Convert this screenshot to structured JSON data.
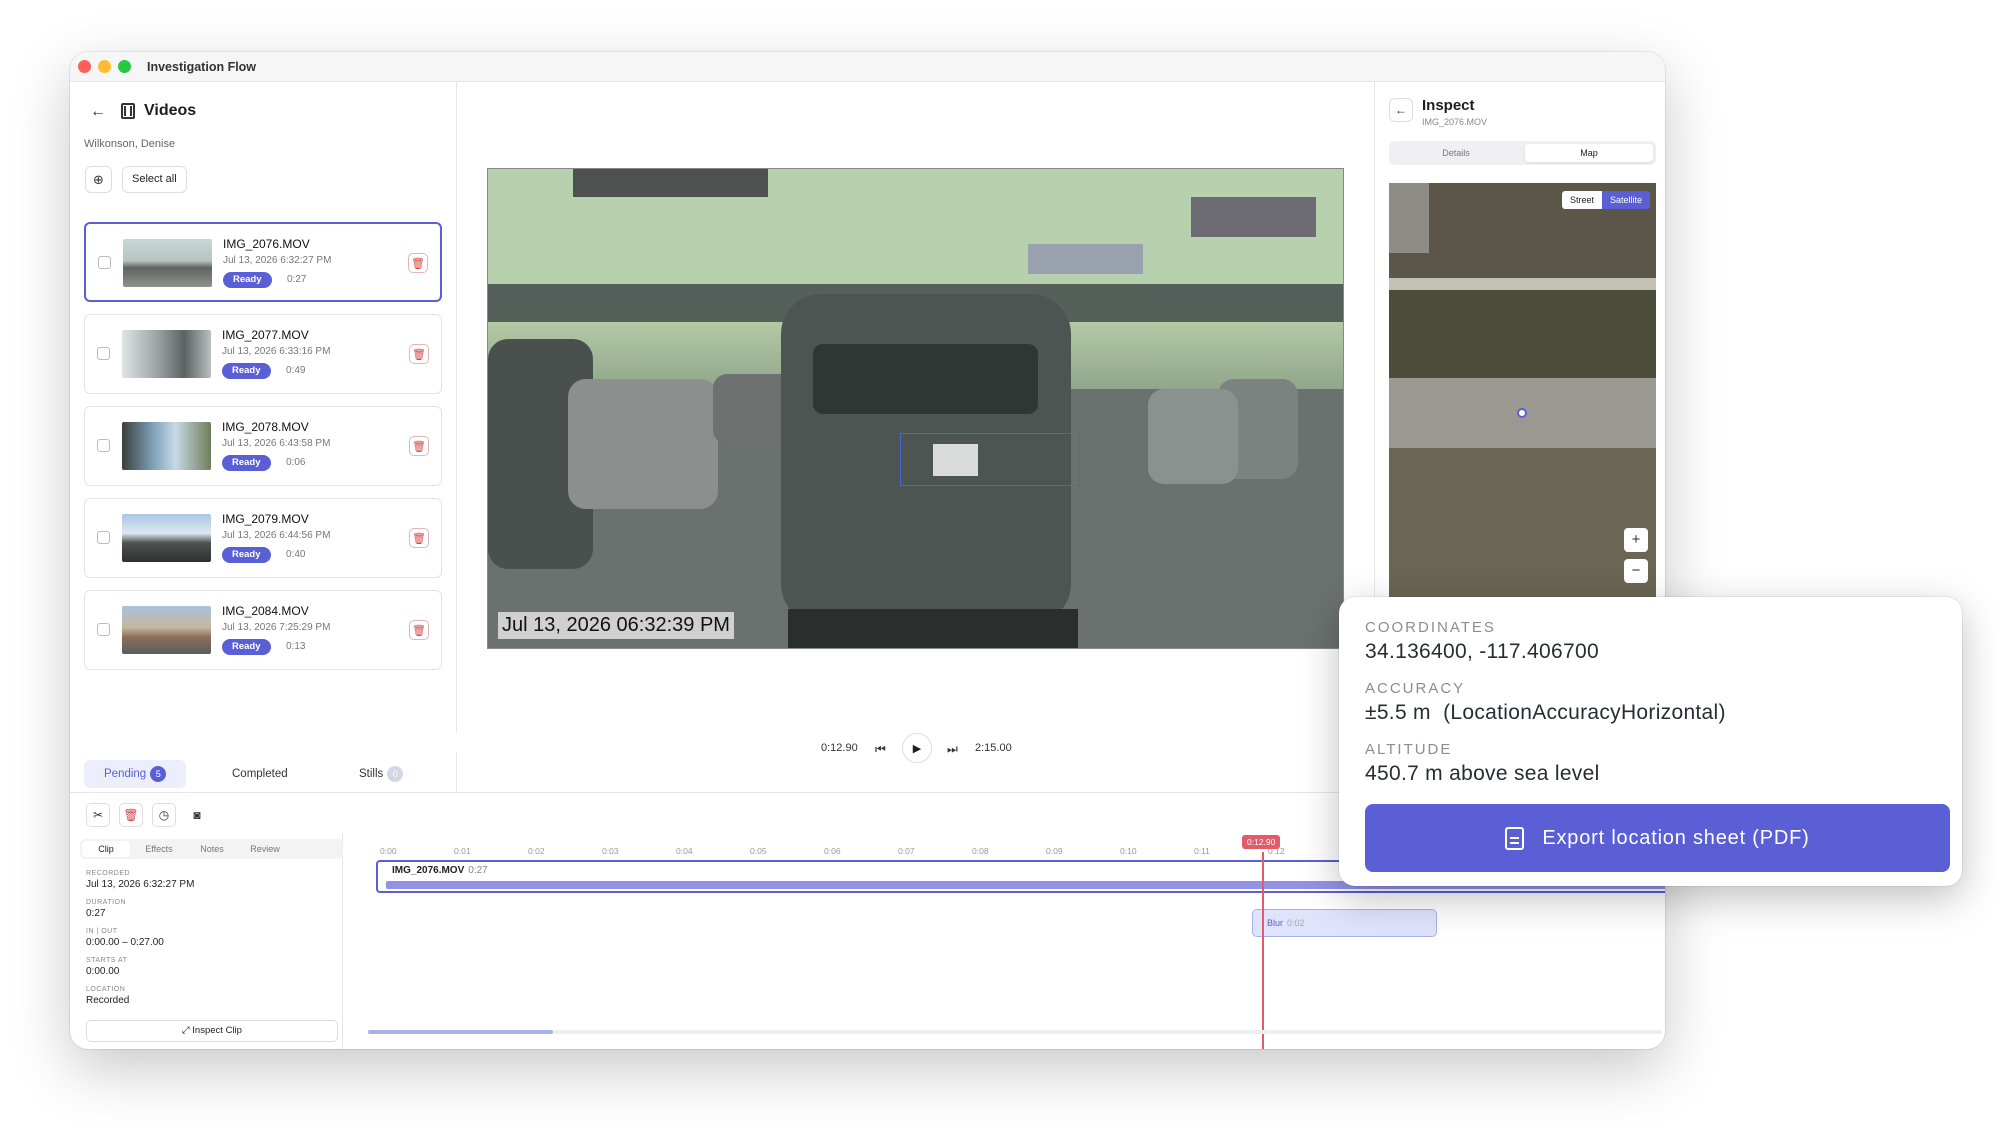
{
  "window": {
    "title": "Investigation Flow"
  },
  "sidebar": {
    "title": "Videos",
    "case_name": "Wilkonson, Denise",
    "select_all_label": "Select all",
    "videos": [
      {
        "name": "IMG_2076.MOV",
        "date": "Jul 13, 2026 6:32:27 PM",
        "status": "Ready",
        "duration": "0:27",
        "selected": true
      },
      {
        "name": "IMG_2077.MOV",
        "date": "Jul 13, 2026 6:33:16 PM",
        "status": "Ready",
        "duration": "0:49"
      },
      {
        "name": "IMG_2078.MOV",
        "date": "Jul 13, 2026 6:43:58 PM",
        "status": "Ready",
        "duration": "0:06"
      },
      {
        "name": "IMG_2079.MOV",
        "date": "Jul 13, 2026 6:44:56 PM",
        "status": "Ready",
        "duration": "0:40"
      },
      {
        "name": "IMG_2084.MOV",
        "date": "Jul 13, 2026 7:25:29 PM",
        "status": "Ready",
        "duration": "0:13"
      }
    ],
    "tabs": [
      {
        "label": "Pending",
        "count": "5"
      },
      {
        "label": "Completed"
      },
      {
        "label": "Stills",
        "count": "0"
      }
    ]
  },
  "player": {
    "timestamp_overlay": "Jul 13, 2026 06:32:39 PM",
    "current_time": "0:12.90",
    "total_time": "2:15.00"
  },
  "inspect": {
    "title": "Inspect",
    "file": "IMG_2076.MOV",
    "tabs": [
      "Details",
      "Map"
    ],
    "active_tab": "Map",
    "map_modes": [
      "Street",
      "Satellite"
    ],
    "active_map_mode": "Satellite",
    "zoom_in": "+",
    "zoom_out": "−"
  },
  "editor": {
    "panel_tabs": [
      "Clip",
      "Effects",
      "Notes",
      "Review"
    ],
    "fields": [
      {
        "label": "RECORDED",
        "value": "Jul 13, 2026 6:32:27 PM"
      },
      {
        "label": "DURATION",
        "value": "0:27"
      },
      {
        "label": "IN | OUT",
        "value": "0:00.00 – 0:27.00"
      },
      {
        "label": "STARTS AT",
        "value": "0:00.00"
      },
      {
        "label": "LOCATION",
        "value": "Recorded"
      }
    ],
    "inspect_clip_label": "Inspect Clip",
    "ruler_ticks": [
      "0:00",
      "0:01",
      "0:02",
      "0:03",
      "0:04",
      "0:05",
      "0:06",
      "0:07",
      "0:08",
      "0:09",
      "0:10",
      "0:11",
      "0:12"
    ],
    "playhead_label": "0:12.90",
    "clip": {
      "name": "IMG_2076.MOV",
      "duration": "0:27"
    },
    "effect": {
      "name": "Blur",
      "duration": "0:02"
    }
  },
  "location": {
    "coordinates_label": "COORDINATES",
    "coordinates": "34.136400, -117.406700",
    "accuracy_label": "ACCURACY",
    "accuracy": "±5.5 m  (LocationAccuracyHorizontal)",
    "altitude_label": "ALTITUDE",
    "altitude": "450.7 m above sea level",
    "export_label": "Export location sheet (PDF)"
  }
}
